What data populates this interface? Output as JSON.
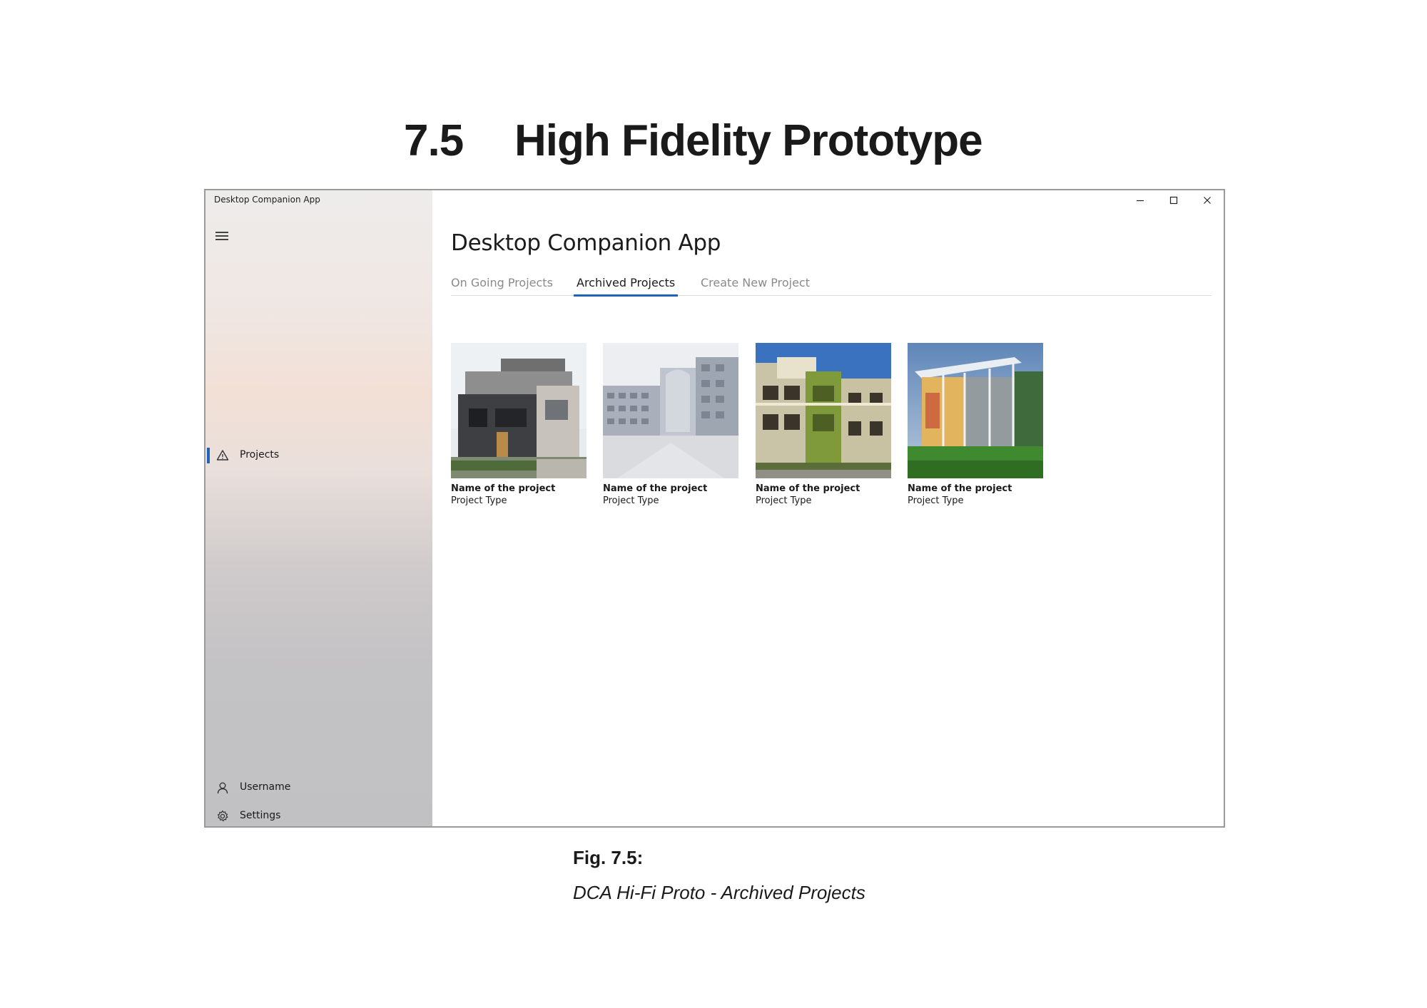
{
  "document": {
    "section_number": "7.5",
    "section_title": "High Fidelity Prototype",
    "figure_label": "Fig. 7.5:",
    "figure_caption": "DCA Hi-Fi Proto - Archived Projects"
  },
  "window": {
    "titlebar_text": "Desktop Companion App",
    "controls": {
      "minimize_icon": "minimize-icon",
      "maximize_icon": "maximize-icon",
      "close_icon": "close-icon"
    }
  },
  "sidebar": {
    "menu_icon": "hamburger-menu-icon",
    "items": [
      {
        "label": "Projects",
        "icon": "warning-triangle-icon",
        "selected": true
      }
    ],
    "footer_items": [
      {
        "label": "Username",
        "icon": "person-icon"
      },
      {
        "label": "Settings",
        "icon": "gear-icon"
      }
    ],
    "accent_color": "#1f63b8"
  },
  "main": {
    "title": "Desktop Companion App",
    "tabs": [
      {
        "label": "On Going Projects",
        "active": false
      },
      {
        "label": "Archived Projects",
        "active": true
      },
      {
        "label": "Create New Project",
        "active": false
      }
    ],
    "projects": [
      {
        "name": "Name of the project",
        "type": "Project Type"
      },
      {
        "name": "Name of the project",
        "type": "Project Type"
      },
      {
        "name": "Name of the project",
        "type": "Project Type"
      },
      {
        "name": "Name of the project",
        "type": "Project Type"
      }
    ]
  }
}
